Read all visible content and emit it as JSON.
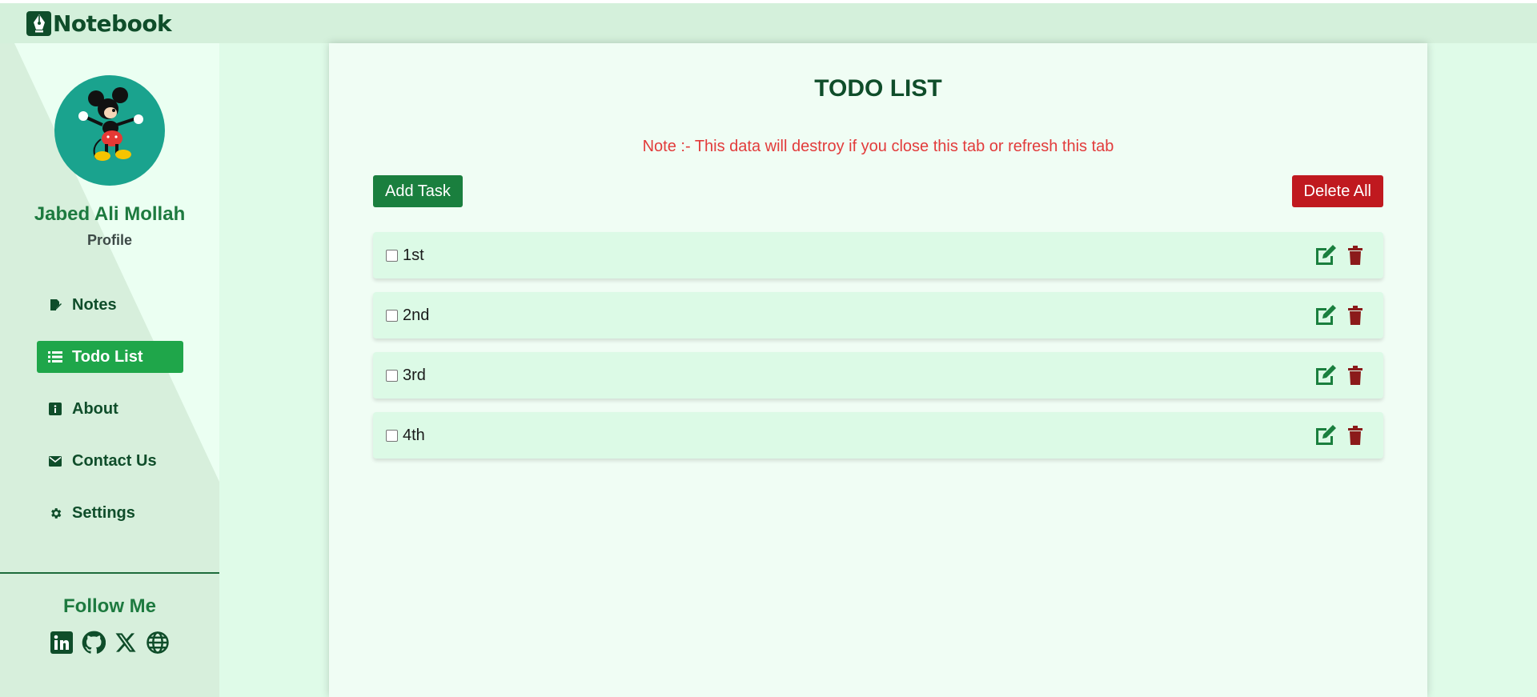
{
  "app": {
    "name": "Notebook"
  },
  "profile": {
    "name": "Jabed Ali Mollah",
    "link_label": "Profile"
  },
  "nav": [
    {
      "label": "Notes",
      "icon": "note-edit-icon",
      "active": false
    },
    {
      "label": "Todo List",
      "icon": "list-icon",
      "active": true
    },
    {
      "label": "About",
      "icon": "info-icon",
      "active": false
    },
    {
      "label": "Contact Us",
      "icon": "envelope-icon",
      "active": false
    },
    {
      "label": "Settings",
      "icon": "gear-icon",
      "active": false
    }
  ],
  "follow": {
    "title": "Follow Me",
    "icons": [
      "linkedin-icon",
      "github-icon",
      "x-icon",
      "globe-icon"
    ]
  },
  "todo": {
    "title": "TODO LIST",
    "note": "Note :- This data will destroy if you close this tab or refresh this tab",
    "add_label": "Add Task",
    "delete_all_label": "Delete All",
    "tasks": [
      {
        "label": "1st",
        "checked": false
      },
      {
        "label": "2nd",
        "checked": false
      },
      {
        "label": "3rd",
        "checked": false
      },
      {
        "label": "4th",
        "checked": false
      }
    ]
  },
  "colors": {
    "brand": "#0f4d2a",
    "accent": "#1fa64a",
    "danger": "#c0191f",
    "note": "#e23b3b"
  }
}
